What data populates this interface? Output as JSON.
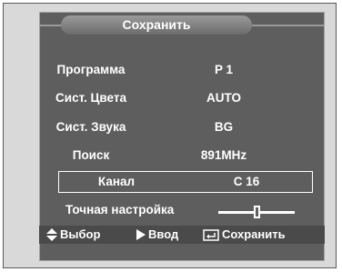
{
  "menu": {
    "title": "Сохранить",
    "rows": [
      {
        "label": "Программа",
        "value": "P  1"
      },
      {
        "label": "Сист. Цвета",
        "value": "AUTO"
      },
      {
        "label": "Сист. Звука",
        "value": "BG"
      },
      {
        "label": "Поиск",
        "value": "891MHz"
      },
      {
        "label": "Канал",
        "value": "C 16",
        "selected": true
      }
    ],
    "fine_tune": {
      "label": "Точная настройка",
      "level": 0.5
    }
  },
  "footer": {
    "select": {
      "label": "Выбор",
      "icon": "up-down-arrows-icon"
    },
    "enter": {
      "label": "Ввод",
      "icon": "play-arrow-icon"
    },
    "save": {
      "label": "Сохранить",
      "icon": "return-icon"
    }
  }
}
